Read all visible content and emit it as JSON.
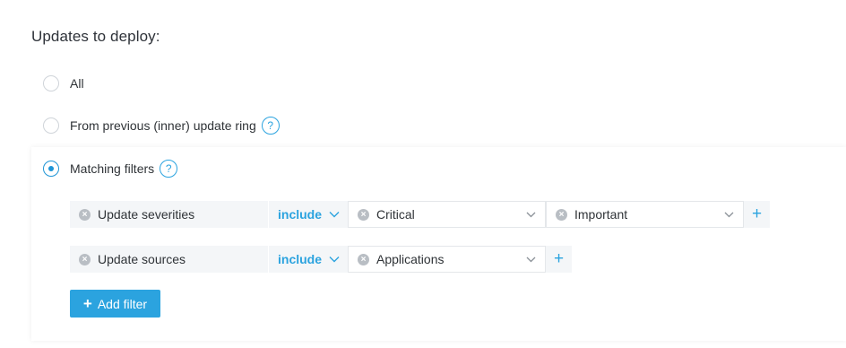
{
  "heading": "Updates to deploy:",
  "options": [
    {
      "label": "All",
      "checked": false,
      "help": false
    },
    {
      "label": "From previous (inner) update ring",
      "checked": false,
      "help": true
    },
    {
      "label": "Matching filters",
      "checked": true,
      "help": true
    }
  ],
  "help_glyph": "?",
  "filters": [
    {
      "name": "Update severities",
      "operator": "include",
      "values": [
        "Critical",
        "Important"
      ]
    },
    {
      "name": "Update sources",
      "operator": "include",
      "values": [
        "Applications"
      ]
    }
  ],
  "add_filter_label": "Add filter",
  "icons": {
    "remove": "x-circle-icon",
    "dropdown": "chevron-down-icon",
    "add": "plus-icon",
    "help": "question-circle-icon"
  },
  "colors": {
    "accent": "#2ba3df",
    "radio_checked": "#1e95d6",
    "row_bg": "#f4f6f8"
  }
}
